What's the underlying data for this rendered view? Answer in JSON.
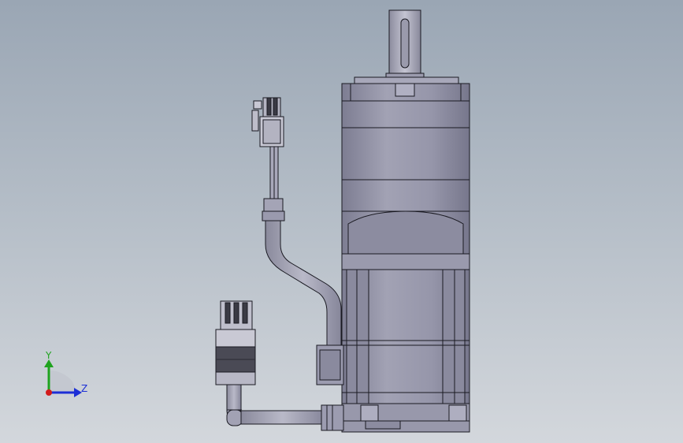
{
  "axes": {
    "y_label": "Y",
    "z_label": "Z",
    "colors": {
      "y": "#1fa31f",
      "z": "#1c2fd6",
      "origin": "#d21c1c"
    }
  },
  "model": {
    "body_color": "#8f8fa3",
    "body_light": "#a9a9bb",
    "body_dark": "#6f6f84",
    "edge_color": "#1a1a22",
    "connector_color": "#c9c9d4",
    "connector_dark": "#3a3a44"
  }
}
